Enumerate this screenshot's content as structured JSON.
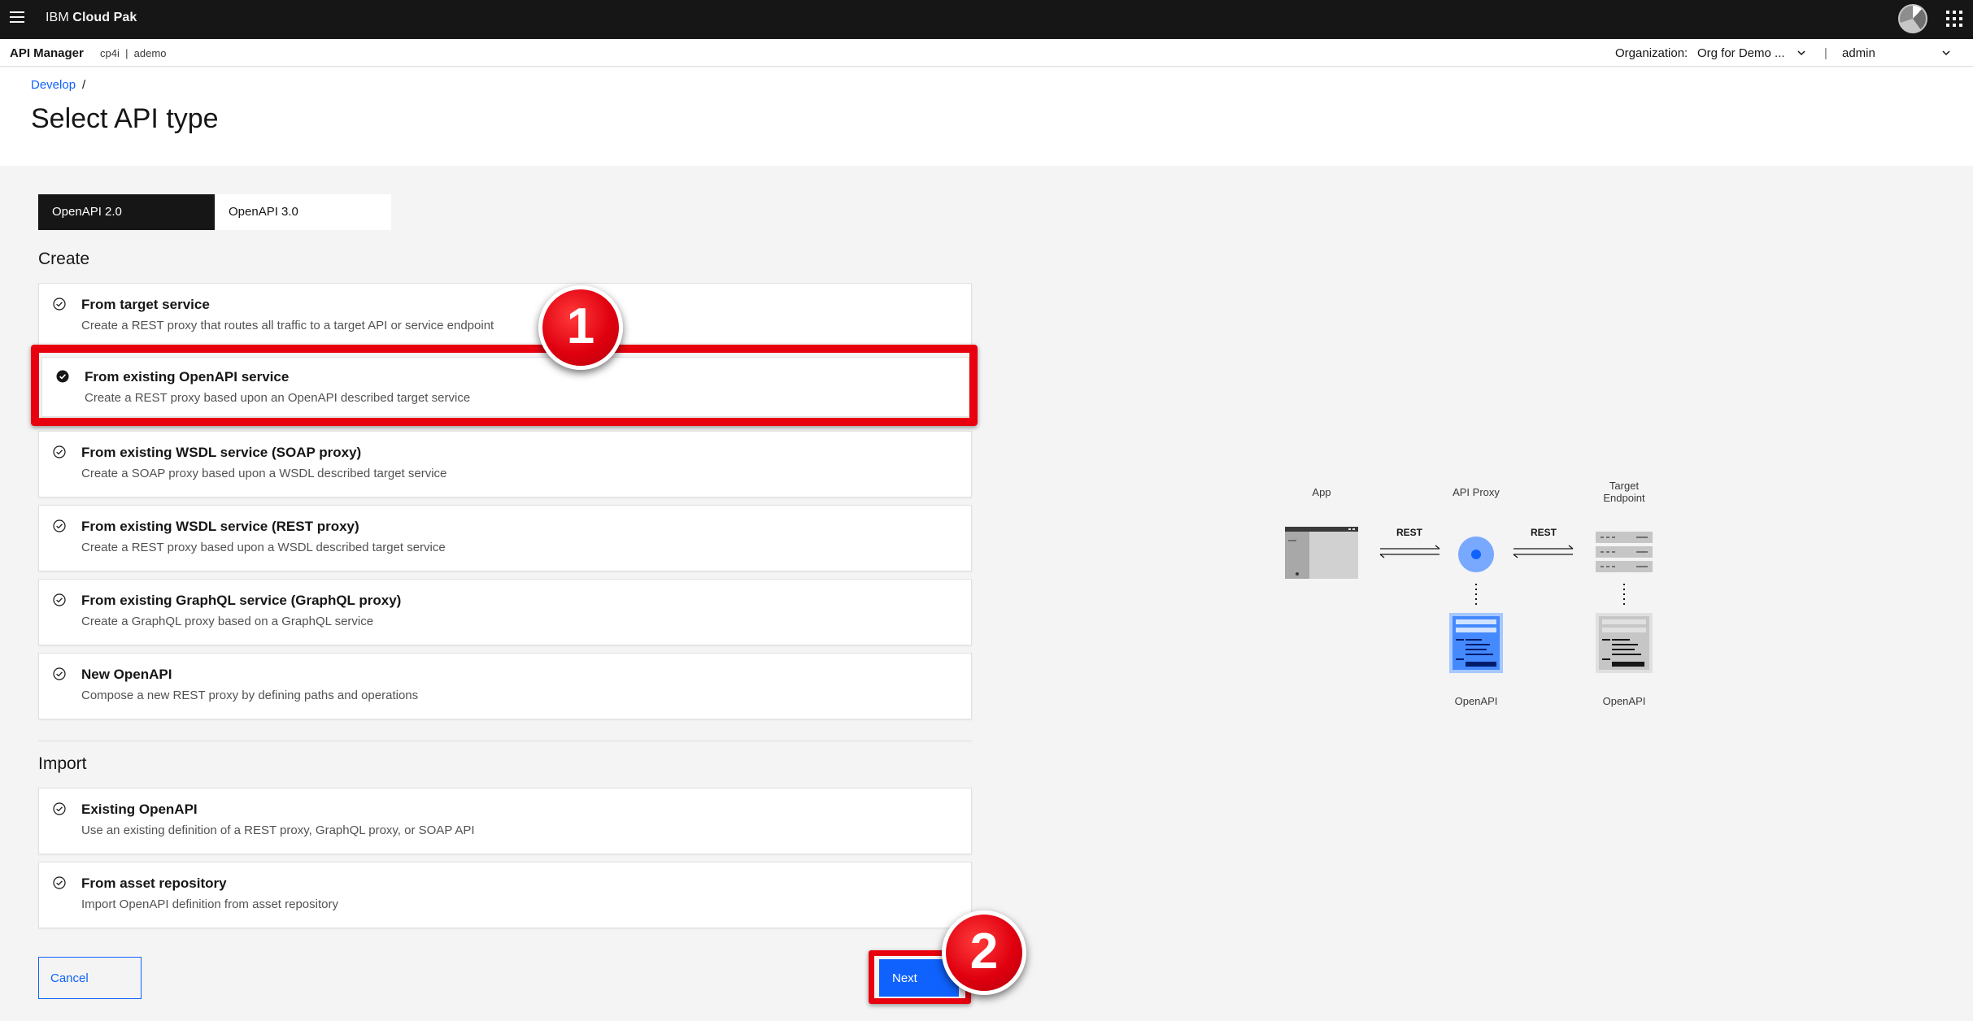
{
  "topbar": {
    "brand_prefix": "IBM ",
    "brand_bold": "Cloud Pak"
  },
  "subbar": {
    "title": "API Manager",
    "context": "cp4i  |  ademo",
    "org_label": "Organization:",
    "org_value": "Org for Demo ...",
    "separator": "|",
    "user": "admin"
  },
  "breadcrumb": {
    "link": "Develop",
    "slash": "/"
  },
  "page_title": "Select API type",
  "tabs": [
    {
      "label": "OpenAPI 2.0",
      "active": true
    },
    {
      "label": "OpenAPI 3.0",
      "active": false
    }
  ],
  "create_section": {
    "label": "Create",
    "options": [
      {
        "title": "From target service",
        "desc": "Create a REST proxy that routes all traffic to a target API or service endpoint",
        "selected": false
      },
      {
        "title": "From existing OpenAPI service",
        "desc": "Create a REST proxy based upon an OpenAPI described target service",
        "selected": true
      },
      {
        "title": "From existing WSDL service (SOAP proxy)",
        "desc": "Create a SOAP proxy based upon a WSDL described target service",
        "selected": false
      },
      {
        "title": "From existing WSDL service (REST proxy)",
        "desc": "Create a REST proxy based upon a WSDL described target service",
        "selected": false
      },
      {
        "title": "From existing GraphQL service (GraphQL proxy)",
        "desc": "Create a GraphQL proxy based on a GraphQL service",
        "selected": false
      },
      {
        "title": "New OpenAPI",
        "desc": "Compose a new REST proxy by defining paths and operations",
        "selected": false
      }
    ]
  },
  "import_section": {
    "label": "Import",
    "options": [
      {
        "title": "Existing OpenAPI",
        "desc": "Use an existing definition of a REST proxy, GraphQL proxy, or SOAP API",
        "selected": false
      },
      {
        "title": "From asset repository",
        "desc": "Import OpenAPI definition from asset repository",
        "selected": false
      }
    ]
  },
  "footer": {
    "cancel_label": "Cancel",
    "next_label": "Next"
  },
  "annotations": {
    "step1": "1",
    "step2": "2"
  },
  "diagram": {
    "app_label": "App",
    "proxy_label": "API Proxy",
    "target_label_line1": "Target",
    "target_label_line2": "Endpoint",
    "rest_left": "REST",
    "rest_right": "REST",
    "openapi_left": "OpenAPI",
    "openapi_right": "OpenAPI"
  },
  "colors": {
    "primary_blue": "#0f62fe",
    "annotation_red": "#e8000f",
    "topbar": "#161616"
  }
}
